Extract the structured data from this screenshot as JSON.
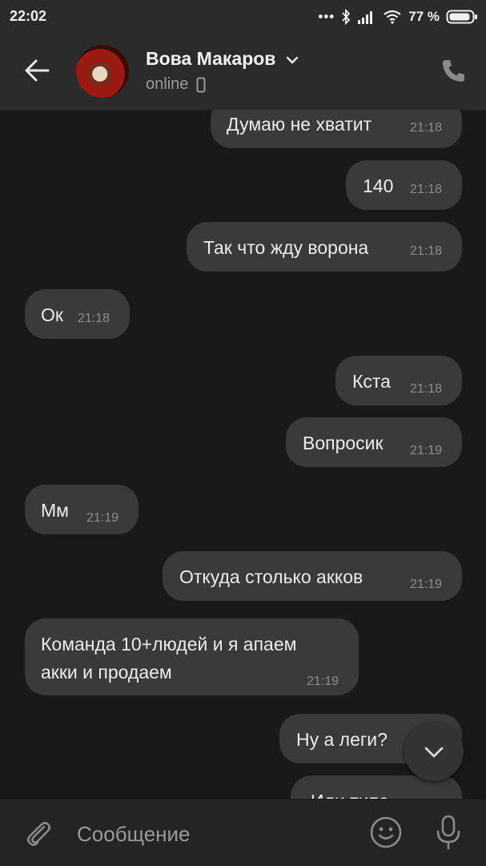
{
  "status_bar": {
    "time": "22:02",
    "battery": "77 %"
  },
  "header": {
    "contact_name": "Вова Макаров",
    "presence": "online"
  },
  "messages": [
    {
      "text": "Думаю не хватит",
      "time": "21:18",
      "side": "out"
    },
    {
      "text": "140",
      "time": "21:18",
      "side": "out"
    },
    {
      "text": "Так что жду ворона",
      "time": "21:18",
      "side": "out"
    },
    {
      "text": "Ок",
      "time": "21:18",
      "side": "in"
    },
    {
      "text": "Кста",
      "time": "21:18",
      "side": "out"
    },
    {
      "text": "Вопросик",
      "time": "21:19",
      "side": "out"
    },
    {
      "text": "Мм",
      "time": "21:19",
      "side": "in"
    },
    {
      "text": "Откуда столько акков",
      "time": "21:19",
      "side": "out"
    },
    {
      "text_line1": "Команда 10+людей и я апаем",
      "text_line2": "акки и продаем",
      "time": "21:19",
      "side": "in"
    },
    {
      "text": "Ну а леги?",
      "side": "out"
    },
    {
      "text": "Или типо",
      "side": "out"
    }
  ],
  "composer": {
    "placeholder": "Сообщение"
  },
  "icons": [
    "back-arrow-icon",
    "chevron-down-icon",
    "mobile-device-icon",
    "phone-icon",
    "chevron-down-icon",
    "paperclip-icon",
    "smiley-icon",
    "microphone-icon"
  ],
  "colors": {
    "background": "#191919",
    "bar": "#2b2b2b",
    "bubble": "#3a3a3a",
    "muted_text": "#8c8c8c"
  }
}
